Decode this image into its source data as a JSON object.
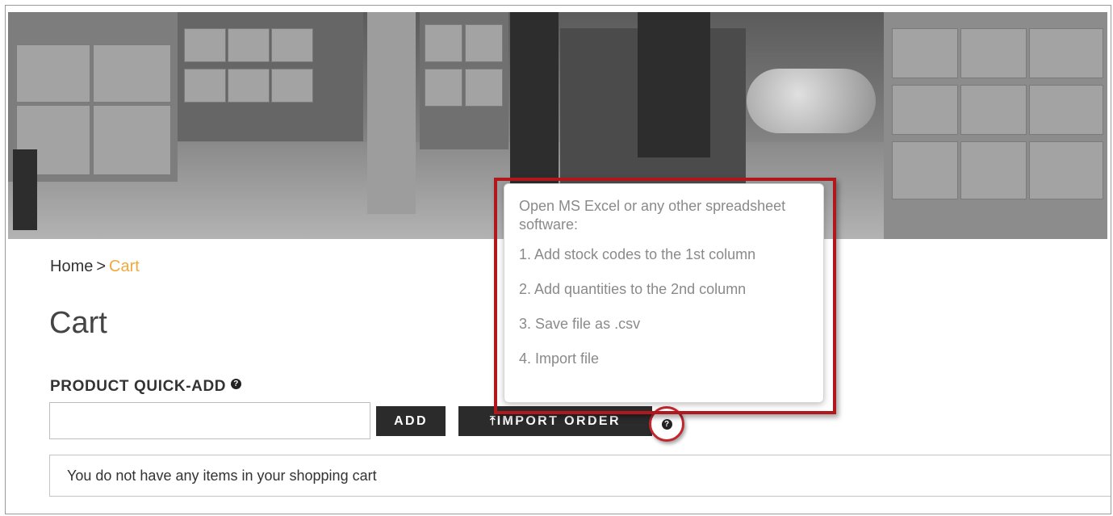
{
  "breadcrumb": {
    "home": "Home",
    "separator": ">",
    "current": "Cart"
  },
  "page": {
    "title": "Cart"
  },
  "quick_add": {
    "heading": "PRODUCT QUICK-ADD",
    "input_value": "",
    "add_label": "ADD",
    "import_label": "IMPORT ORDER",
    "import_icon": "upload-icon",
    "help_icon": "question-icon"
  },
  "cart": {
    "empty_message": "You do not have any items in your shopping cart"
  },
  "tooltip": {
    "intro": "Open MS Excel or any other spreadsheet software:",
    "steps": [
      "1. Add stock codes to the 1st column",
      "2. Add quantities to the 2nd column",
      "3. Save file as .csv",
      "4. Import file"
    ]
  },
  "colors": {
    "accent": "#f2a93b",
    "button_dark": "#2b2b2b",
    "highlight_red": "#b0181d",
    "tooltip_text": "#8a8a8a"
  }
}
